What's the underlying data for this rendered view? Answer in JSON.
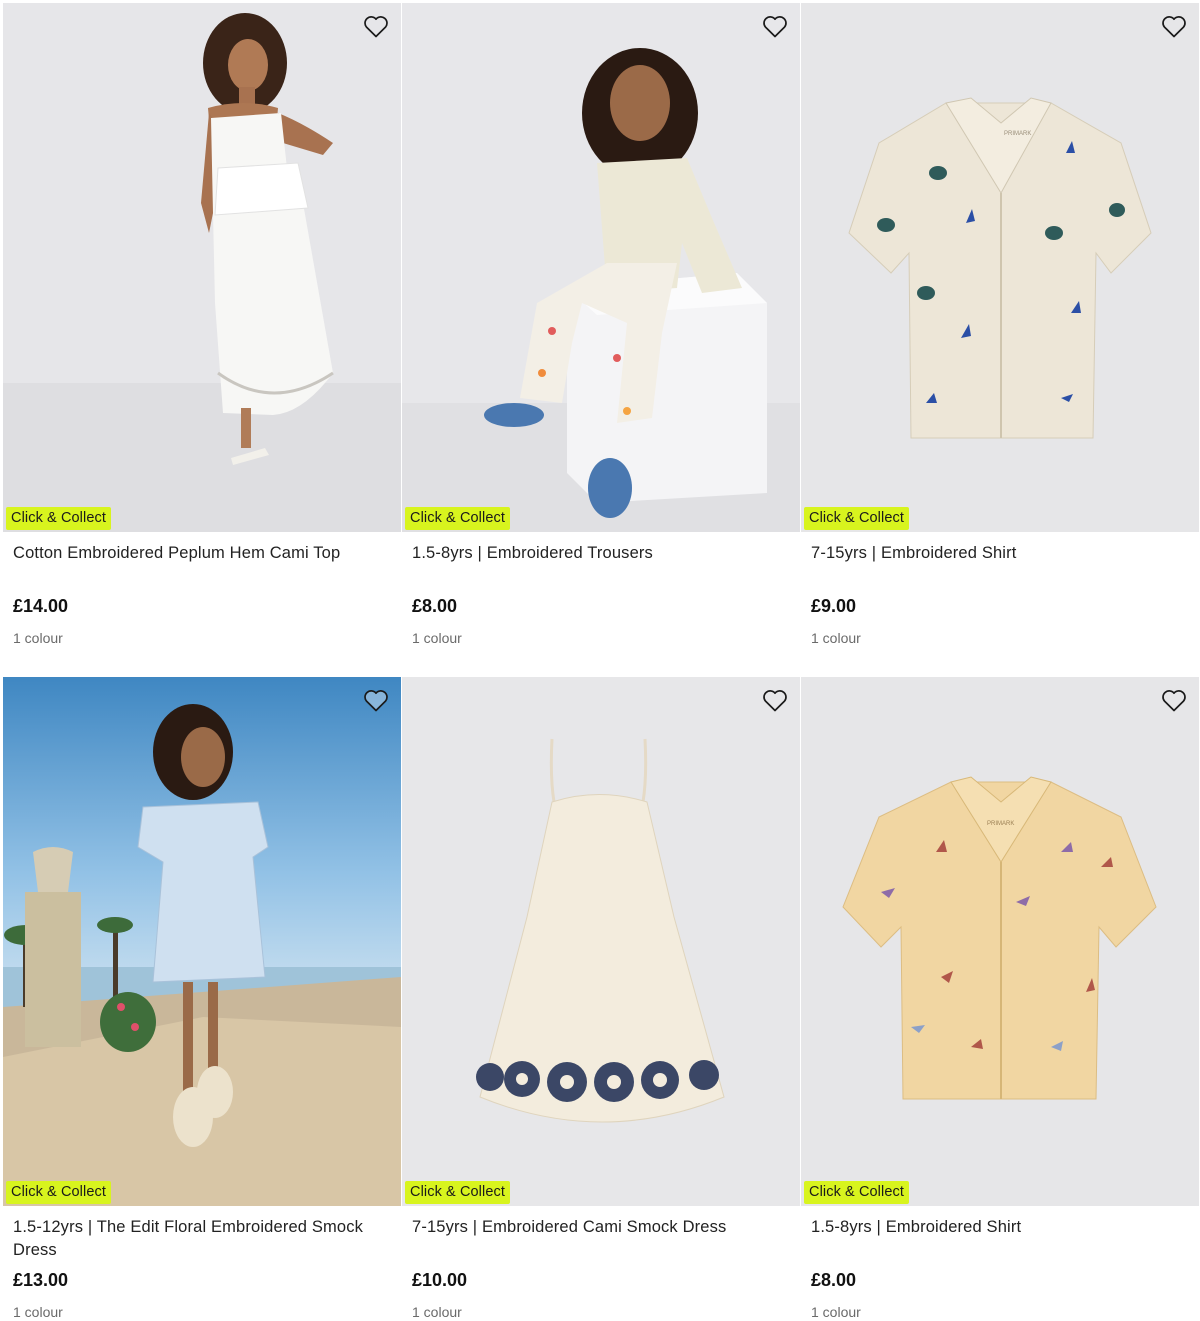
{
  "products": [
    {
      "badge": "Click & Collect",
      "title": "Cotton Embroidered Peplum Hem Cami Top",
      "price": "£14.00",
      "colours": "1 colour"
    },
    {
      "badge": "Click & Collect",
      "title": "1.5-8yrs | Embroidered Trousers",
      "price": "£8.00",
      "colours": "1 colour"
    },
    {
      "badge": "Click & Collect",
      "title": "7-15yrs | Embroidered Shirt",
      "price": "£9.00",
      "colours": "1 colour"
    },
    {
      "badge": "Click & Collect",
      "title": "1.5-12yrs | The Edit Floral Embroidered Smock Dress",
      "price": "£13.00",
      "colours": "1 colour"
    },
    {
      "badge": "Click & Collect",
      "title": "7-15yrs | Embroidered Cami Smock Dress",
      "price": "£10.00",
      "colours": "1 colour"
    },
    {
      "badge": "Click & Collect",
      "title": "1.5-8yrs | Embroidered Shirt",
      "price": "£8.00",
      "colours": "1 colour"
    }
  ],
  "image_text": {
    "shirt_label": "PRIMARK",
    "shirt_label_2": "PRIMARK"
  },
  "icons": {
    "wishlist": "heart-outline-icon"
  },
  "colors": {
    "badge_bg": "#d8f41e",
    "price_text": "#111111",
    "muted_text": "#6a6a6a",
    "image_bg": "#e8e8ea"
  }
}
